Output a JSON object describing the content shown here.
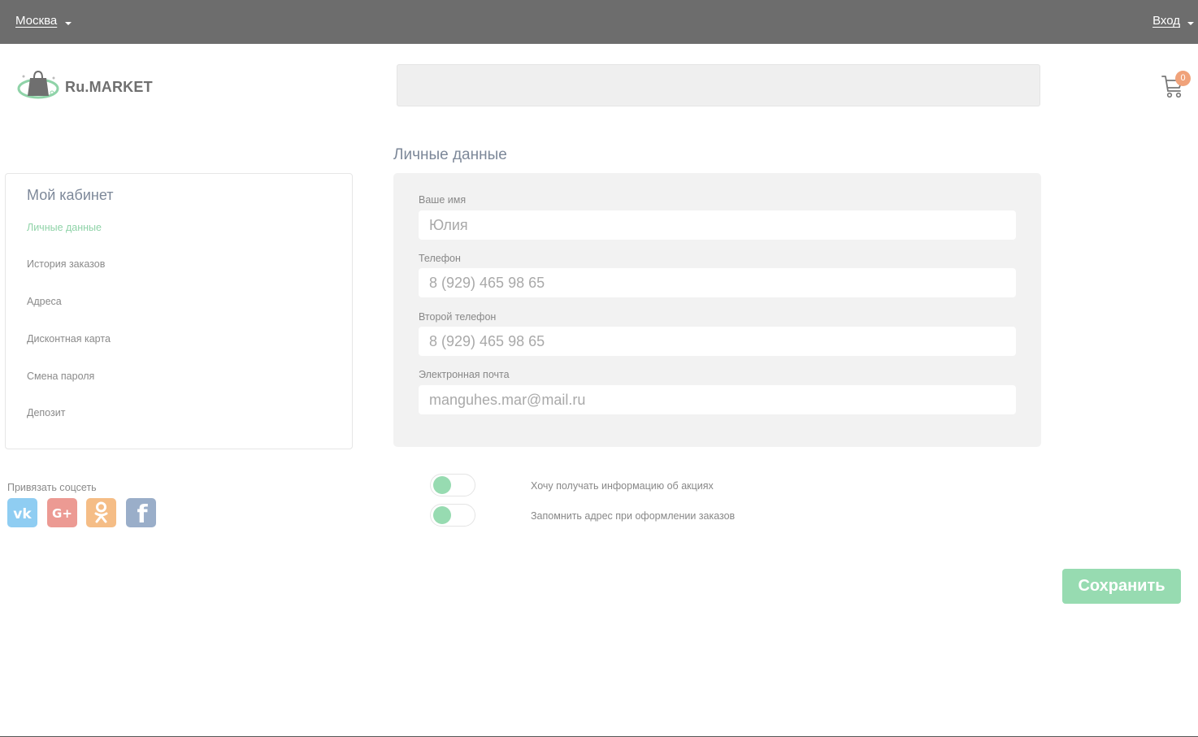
{
  "topbar": {
    "city": "Москва",
    "login": "Вход"
  },
  "logo": {
    "text": "Ru.MARKET"
  },
  "cart": {
    "count": "0"
  },
  "sidebar": {
    "title": "Мой кабинет",
    "items": [
      {
        "label": "Личные данные",
        "active": true
      },
      {
        "label": "История заказов"
      },
      {
        "label": "Адреса"
      },
      {
        "label": "Дисконтная карта"
      },
      {
        "label": "Смена пароля"
      },
      {
        "label": "Депозит"
      }
    ]
  },
  "social": {
    "label": "Привязать соцсеть",
    "icons": [
      "vk-icon",
      "google-plus-icon",
      "odnoklassniki-icon",
      "facebook-icon"
    ]
  },
  "main": {
    "title": "Личные данные",
    "fields": [
      {
        "label": "Ваше имя",
        "value": "Юлия"
      },
      {
        "label": "Телефон",
        "value": "8 (929) 465 98 65"
      },
      {
        "label": "Второй телефон",
        "value": "8 (929) 465 98 65"
      },
      {
        "label": "Электронная почта",
        "value": "manguhes.mar@mail.ru"
      }
    ],
    "toggles": [
      {
        "label": "Хочу получать информацию об акциях",
        "on": true
      },
      {
        "label": "Запомнить адрес при оформлении заказов",
        "on": true
      }
    ],
    "save_label": "Сохранить"
  },
  "colors": {
    "topbar": "#6d6d6d",
    "accent": "#97dbb1",
    "badge": "#f0a27a"
  }
}
